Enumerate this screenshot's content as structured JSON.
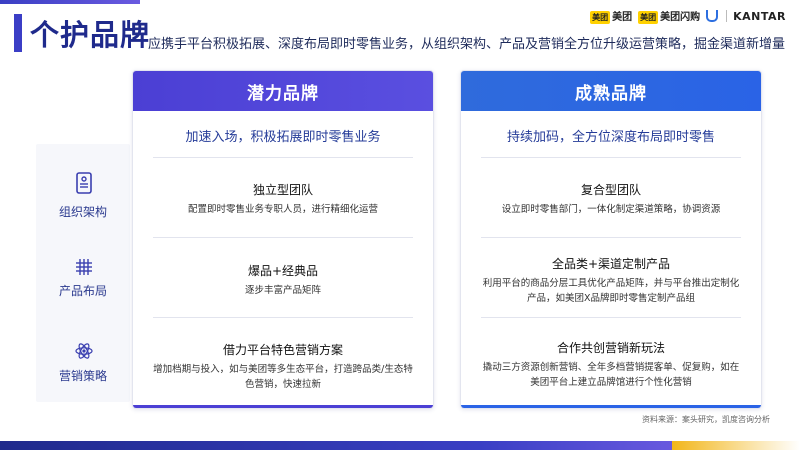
{
  "header": {
    "title": "个护品牌",
    "subtitle": "应携手平台积极拓展、深度布局即时零售业务，从组织架构、产品及营销全方位升级运营策略，掘金渠道新增量"
  },
  "logos": {
    "meituan_chip": "美团",
    "meituan": "美团",
    "flash_chip": "美团",
    "flash": "美团闪购",
    "kantar": "KANTAR"
  },
  "rows": [
    {
      "label": "组织架构",
      "icon": "org-structure-icon"
    },
    {
      "label": "产品布局",
      "icon": "grid-icon"
    },
    {
      "label": "营销策略",
      "icon": "atom-icon"
    }
  ],
  "cards": [
    {
      "title": "潜力品牌",
      "tagline": "加速入场，积极拓展即时零售业务",
      "blocks": [
        {
          "title": "独立型团队",
          "desc": "配置即时零售业务专职人员，进行精细化运营"
        },
        {
          "title": "爆品+经典品",
          "desc": "逐步丰富产品矩阵"
        },
        {
          "title": "借力平台特色营销方案",
          "desc": "增加档期与投入，如与美团等多生态平台，打造跨品类/生态特色营销，快速拉新"
        }
      ]
    },
    {
      "title": "成熟品牌",
      "tagline": "持续加码，全方位深度布局即时零售",
      "blocks": [
        {
          "title": "复合型团队",
          "desc": "设立即时零售部门，一体化制定渠道策略，协调资源"
        },
        {
          "title": "全品类+渠道定制产品",
          "desc": "利用平台的商品分层工具优化产品矩阵，并与平台推出定制化产品，如美团X品牌即时零售定制产品组"
        },
        {
          "title": "合作共创营销新玩法",
          "desc": "撬动三方资源创新营销、全年多档营销提客单、促复购，如在美团平台上建立品牌馆进行个性化营销"
        }
      ]
    }
  ],
  "source": "资料来源：案头研究，凯度咨询分析",
  "colors": {
    "brand_navy": "#1f2a8c",
    "potential_purple": "#4b3fd4",
    "mature_blue": "#2a63e6",
    "accent_yellow": "#f2b61a"
  }
}
